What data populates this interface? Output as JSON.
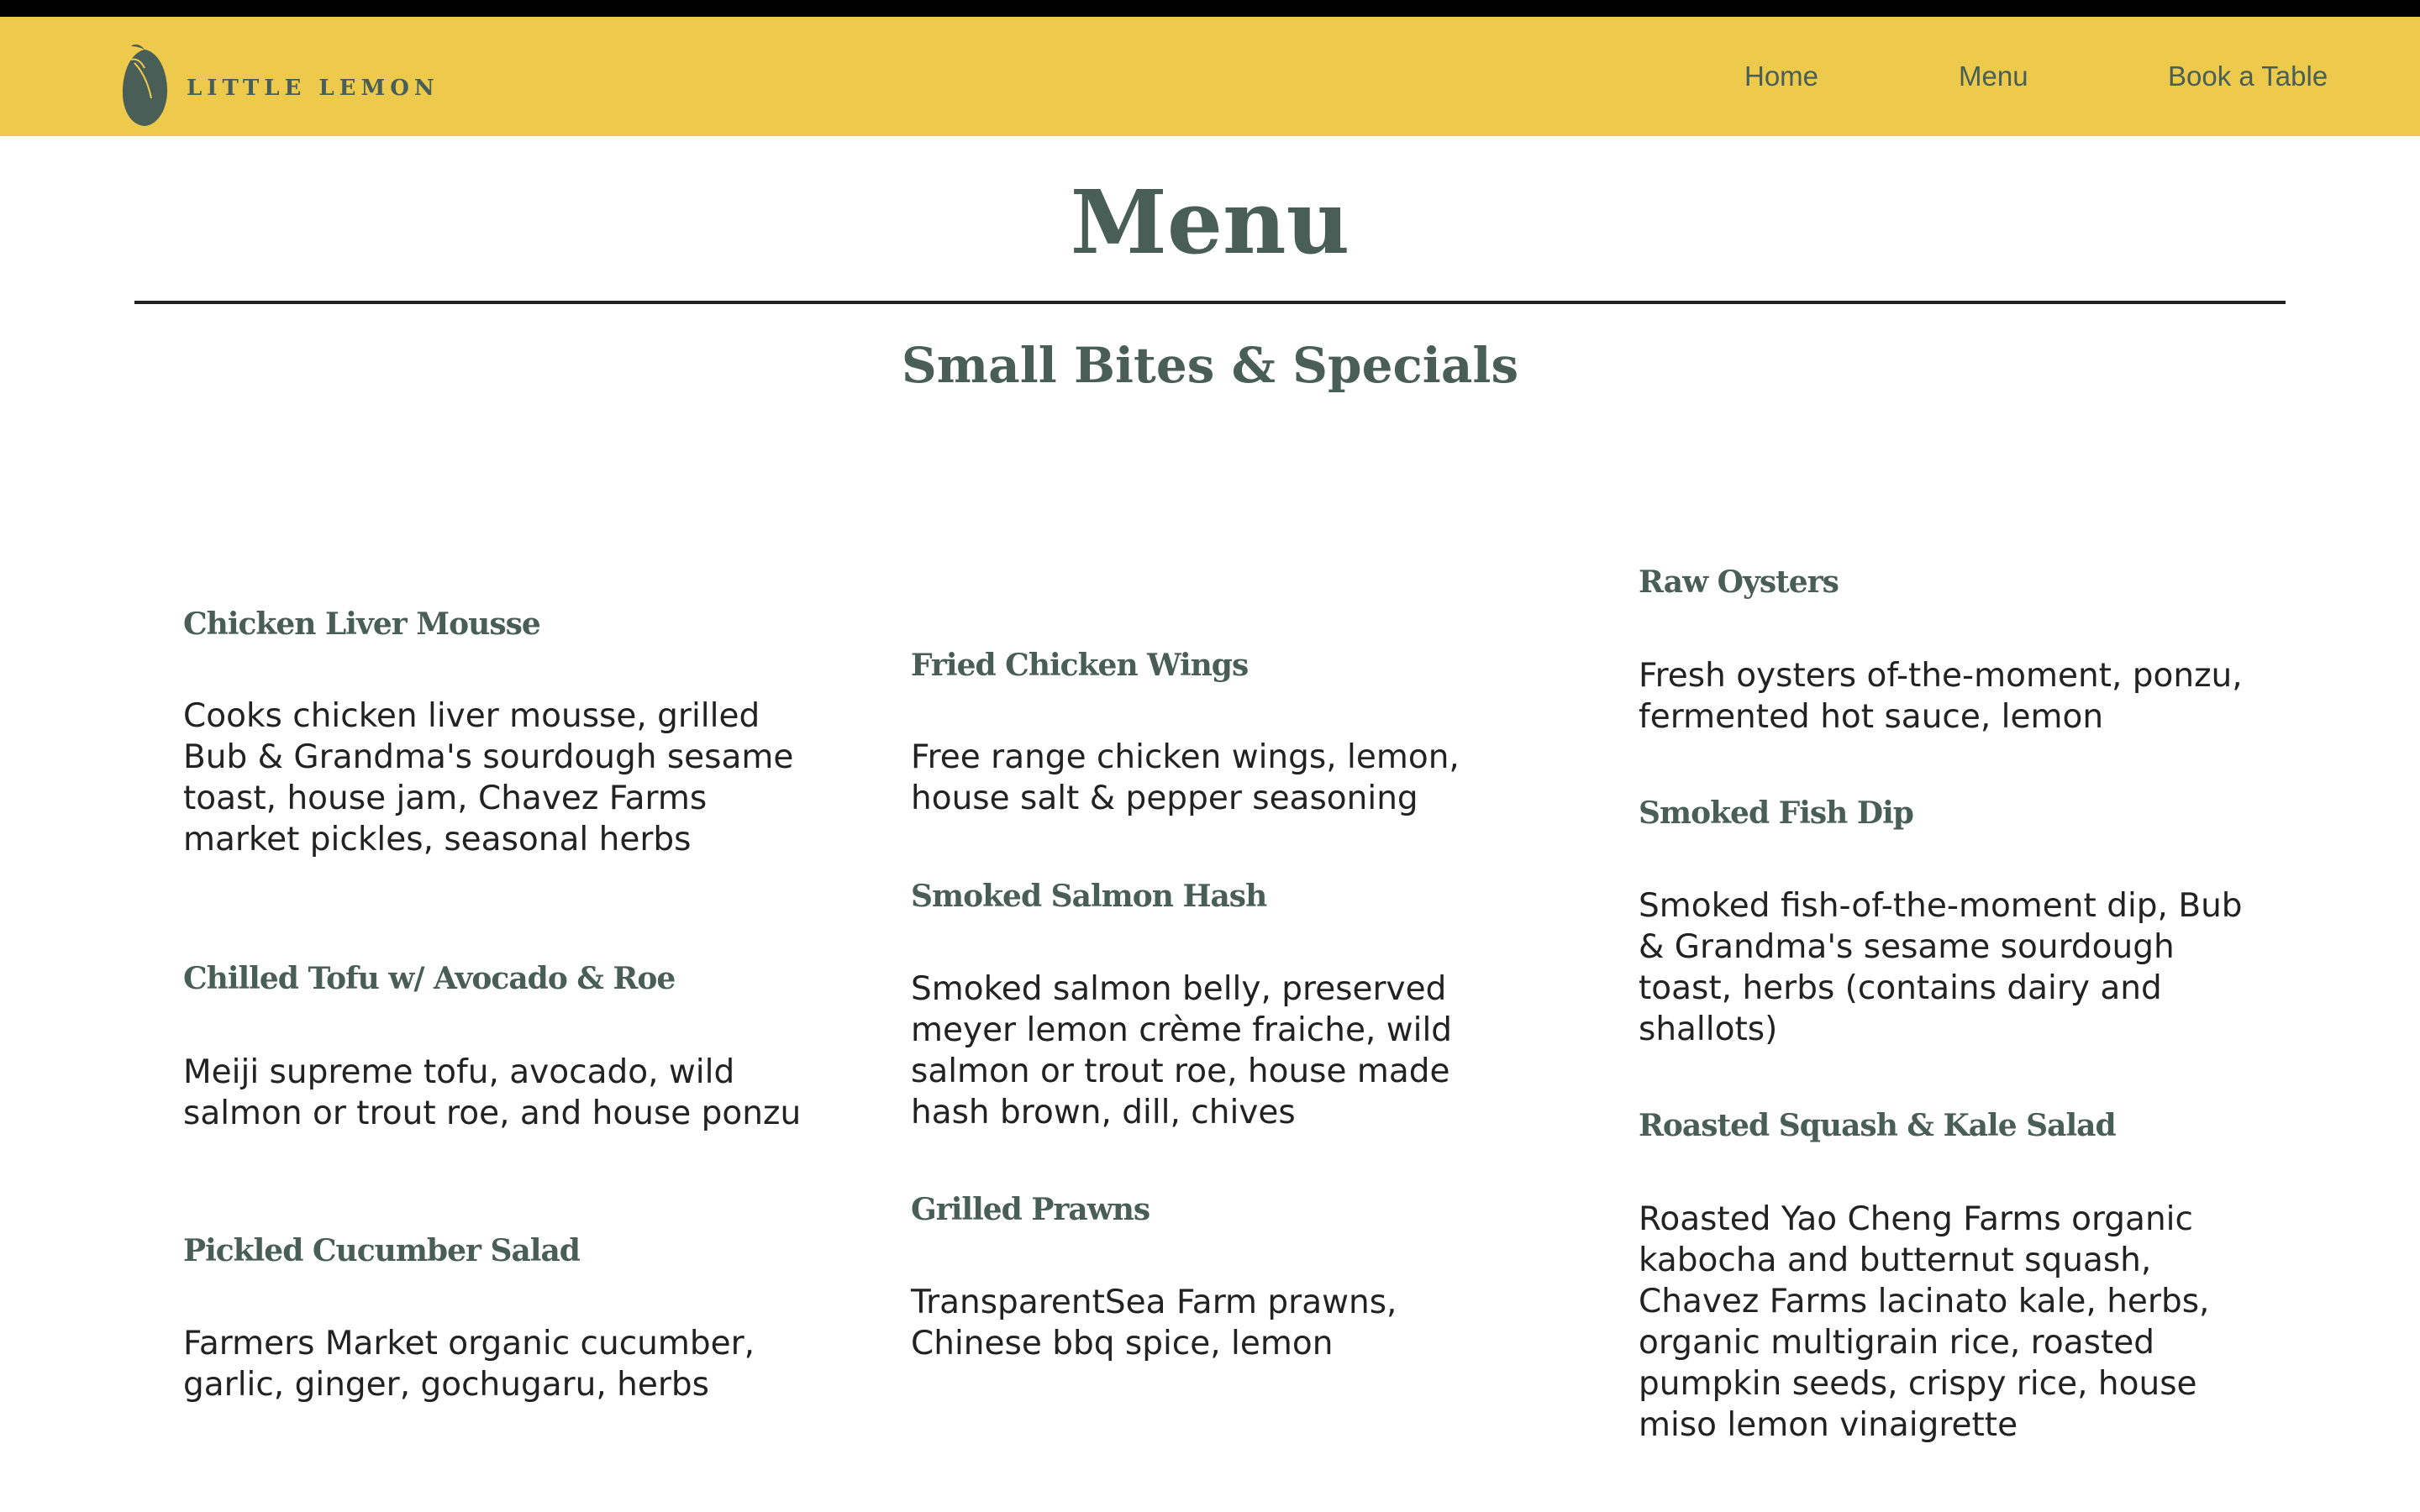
{
  "brand": {
    "name": "LITTLE LEMON",
    "logo_icon": "lemon-icon",
    "colors": {
      "primary": "#495E57",
      "accent": "#EDCA4C"
    }
  },
  "nav": {
    "items": [
      {
        "label": "Home"
      },
      {
        "label": "Menu"
      },
      {
        "label": "Book a Table"
      }
    ]
  },
  "page": {
    "title": "Menu",
    "section_title": "Small Bites & Specials"
  },
  "menu": {
    "columns": [
      {
        "items": [
          {
            "name": "Chicken Liver Mousse",
            "description": "Cooks chicken liver mousse, grilled Bub & Grandma's sourdough sesame toast, house jam, Chavez Farms market pickles, seasonal herbs"
          },
          {
            "name": "Chilled Tofu w/ Avocado & Roe",
            "description": "Meiji supreme tofu, avocado, wild salmon or trout roe, and house ponzu"
          },
          {
            "name": "Pickled Cucumber Salad",
            "description": "Farmers Market organic cucumber, garlic, ginger, gochugaru, herbs"
          }
        ]
      },
      {
        "items": [
          {
            "name": "Fried Chicken Wings",
            "description": "Free range chicken wings, lemon, house salt & pepper seasoning"
          },
          {
            "name": "Smoked Salmon Hash",
            "description": "Smoked salmon belly, preserved meyer lemon crème fraiche, wild salmon or trout roe, house made hash brown, dill, chives"
          },
          {
            "name": "Grilled Prawns",
            "description": "TransparentSea Farm prawns, Chinese bbq spice, lemon"
          }
        ]
      },
      {
        "items": [
          {
            "name": "Raw Oysters",
            "description": "Fresh oysters of-the-moment, ponzu, fermented hot sauce, lemon"
          },
          {
            "name": "Smoked Fish Dip",
            "description": "Smoked fish-of-the-moment dip, Bub & Grandma's sesame sourdough toast, herbs (contains dairy and shallots)"
          },
          {
            "name": "Roasted Squash & Kale Salad",
            "description": "Roasted Yao Cheng Farms organic kabocha and butternut squash, Chavez Farms lacinato kale, herbs, organic multigrain rice, roasted pumpkin seeds, crispy rice, house miso lemon vinaigrette"
          }
        ]
      }
    ]
  }
}
